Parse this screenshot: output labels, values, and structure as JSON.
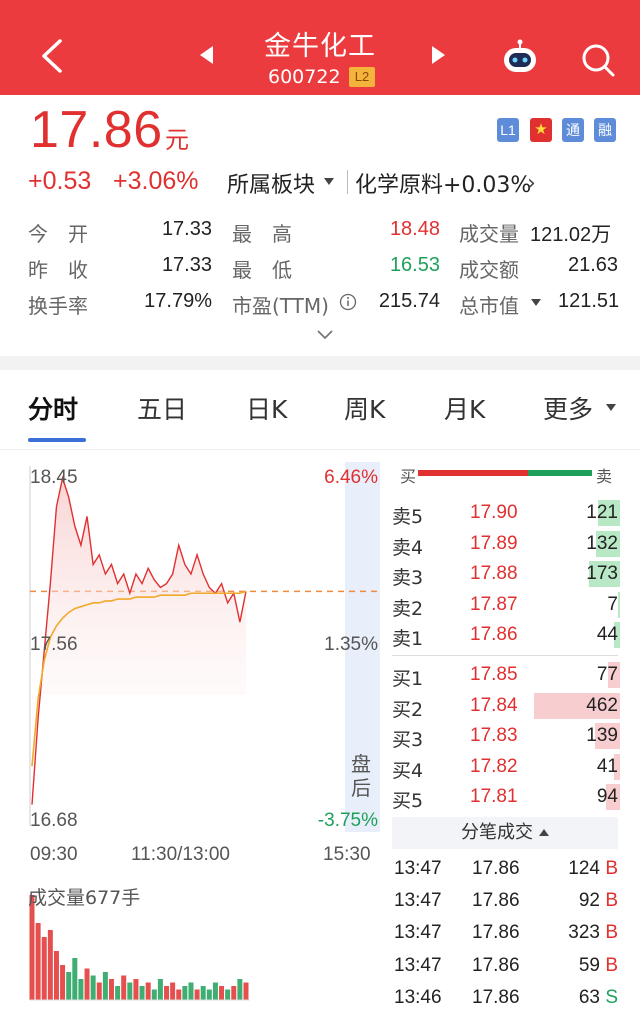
{
  "header": {
    "stock_name": "金牛化工",
    "stock_code": "600722",
    "level_badge": "L2",
    "bg_color": "#ec3b3e",
    "icons": [
      "back-arrow-icon",
      "prev-stock-icon",
      "next-stock-icon",
      "robot-assistant-icon",
      "search-icon"
    ]
  },
  "quote": {
    "price": "17.86",
    "unit": "元",
    "change": "+0.53",
    "change_pct": "+3.06%",
    "sector_label": "所属板块",
    "industry": "化学原料+0.03%",
    "badges": [
      "L1",
      "★",
      "通",
      "融"
    ]
  },
  "stats": {
    "open_label": "今　开",
    "open": "17.33",
    "high_label": "最　高",
    "high": "18.48",
    "volume_label": "成交量",
    "volume": "121.02万",
    "prev_label": "昨　收",
    "prev": "17.33",
    "low_label": "最　低",
    "low": "16.53",
    "amount_label": "成交额",
    "amount": "21.63",
    "turnover_label": "换手率",
    "turnover": "17.79%",
    "pe_label": "市盈(TTM)",
    "pe": "215.74",
    "mcap_label": "总市值",
    "mcap": "121.51"
  },
  "tabs": [
    "分时",
    "五日",
    "日K",
    "周K",
    "月K",
    "更多"
  ],
  "chart_data": {
    "type": "line",
    "title": "",
    "y_labels": [
      "18.45",
      "17.56",
      "16.68"
    ],
    "pct_labels": [
      "6.46%",
      "1.35%",
      "-3.75%"
    ],
    "x_labels": [
      "09:30",
      "11:30/13:00",
      "15:30"
    ],
    "after_hours_label": "盘后",
    "ylim": [
      16.68,
      18.45
    ],
    "prev_close": 17.33,
    "series": [
      {
        "values": [
          16.75,
          17.2,
          17.55,
          17.9,
          18.3,
          18.45,
          18.35,
          18.2,
          18.1,
          18.25,
          18.0,
          18.05,
          17.95,
          18.0,
          17.9,
          17.95,
          17.85,
          17.95,
          17.9,
          17.98,
          17.92,
          17.88,
          17.9,
          17.95,
          18.1,
          18.0,
          17.95,
          18.05,
          17.95,
          17.88,
          17.85,
          17.9,
          17.8,
          17.85,
          17.7,
          17.86
        ]
      },
      {
        "values": [
          16.95,
          17.3,
          17.5,
          17.62,
          17.68,
          17.72,
          17.75,
          17.77,
          17.78,
          17.79,
          17.8,
          17.8,
          17.81,
          17.81,
          17.82,
          17.82,
          17.82,
          17.83,
          17.83,
          17.83,
          17.83,
          17.84,
          17.84,
          17.84,
          17.84,
          17.84,
          17.85,
          17.85,
          17.85,
          17.85,
          17.85,
          17.85,
          17.85,
          17.85,
          17.85,
          17.86
        ]
      }
    ],
    "volume_label": "成交量677手",
    "volume": [
      30,
      22,
      18,
      20,
      14,
      10,
      8,
      12,
      6,
      9,
      7,
      5,
      8,
      6,
      4,
      7,
      5,
      6,
      4,
      5,
      3,
      6,
      4,
      5,
      3,
      4,
      5,
      3,
      4,
      3,
      5,
      4,
      3,
      4,
      6,
      5
    ]
  },
  "orderbook": {
    "buy_label": "买",
    "sell_label": "卖",
    "asks": [
      {
        "name": "卖5",
        "price": "17.90",
        "qty": "121",
        "depth": 0.18
      },
      {
        "name": "卖4",
        "price": "17.89",
        "qty": "132",
        "depth": 0.2
      },
      {
        "name": "卖3",
        "price": "17.88",
        "qty": "173",
        "depth": 0.26
      },
      {
        "name": "卖2",
        "price": "17.87",
        "qty": "7",
        "depth": 0.02
      },
      {
        "name": "卖1",
        "price": "17.86",
        "qty": "44",
        "depth": 0.05
      }
    ],
    "bids": [
      {
        "name": "买1",
        "price": "17.85",
        "qty": "77",
        "depth": 0.1
      },
      {
        "name": "买2",
        "price": "17.84",
        "qty": "462",
        "depth": 0.72
      },
      {
        "name": "买3",
        "price": "17.83",
        "qty": "139",
        "depth": 0.21
      },
      {
        "name": "买4",
        "price": "17.82",
        "qty": "41",
        "depth": 0.05
      },
      {
        "name": "买5",
        "price": "17.81",
        "qty": "94",
        "depth": 0.12
      }
    ]
  },
  "ticks": {
    "title": "分笔成交",
    "rows": [
      {
        "time": "13:47",
        "price": "17.86",
        "qty": "124",
        "side": "B"
      },
      {
        "time": "13:47",
        "price": "17.86",
        "qty": "92",
        "side": "B"
      },
      {
        "time": "13:47",
        "price": "17.86",
        "qty": "323",
        "side": "B"
      },
      {
        "time": "13:47",
        "price": "17.86",
        "qty": "59",
        "side": "B"
      },
      {
        "time": "13:46",
        "price": "17.86",
        "qty": "63",
        "side": "S"
      }
    ]
  },
  "colors": {
    "up": "#e0302f",
    "down": "#1fa05a",
    "accent": "#3a6fd8"
  }
}
